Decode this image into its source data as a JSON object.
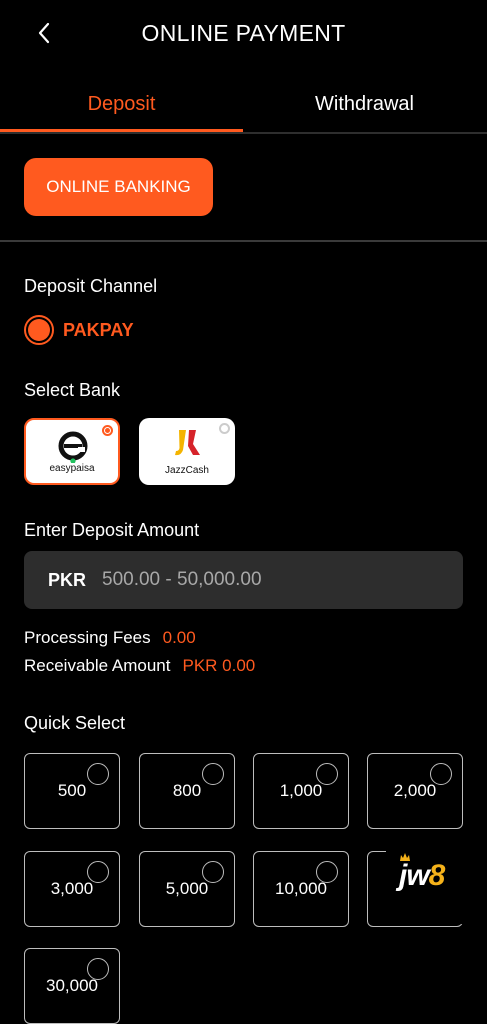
{
  "header": {
    "title": "ONLINE PAYMENT",
    "back_icon": "chevron-left-icon"
  },
  "tabs": [
    {
      "label": "Deposit",
      "active": true
    },
    {
      "label": "Withdrawal",
      "active": false
    }
  ],
  "bank_type_button": "ONLINE BANKING",
  "deposit_channel": {
    "label": "Deposit Channel",
    "option": "PAKPAY",
    "selected": true
  },
  "select_bank": {
    "label": "Select Bank",
    "banks": [
      {
        "name": "easypaisa",
        "selected": true
      },
      {
        "name": "JazzCash",
        "selected": false
      }
    ]
  },
  "deposit_amount": {
    "label": "Enter Deposit Amount",
    "currency": "PKR",
    "placeholder": "500.00 - 50,000.00",
    "value": ""
  },
  "fees": {
    "processing_label": "Processing Fees",
    "processing_value": "0.00",
    "receivable_label": "Receivable Amount",
    "receivable_value": "PKR 0.00"
  },
  "quick_select": {
    "label": "Quick Select",
    "options": [
      "500",
      "800",
      "1,000",
      "2,000",
      "3,000",
      "5,000",
      "10,000",
      "",
      "30,000"
    ]
  },
  "watermark": {
    "text_jw": "jw",
    "text_8": "8"
  },
  "colors": {
    "accent": "#ff5a1f",
    "background": "#000000",
    "field": "#2d2d2d",
    "gold": "#f5b21a"
  }
}
